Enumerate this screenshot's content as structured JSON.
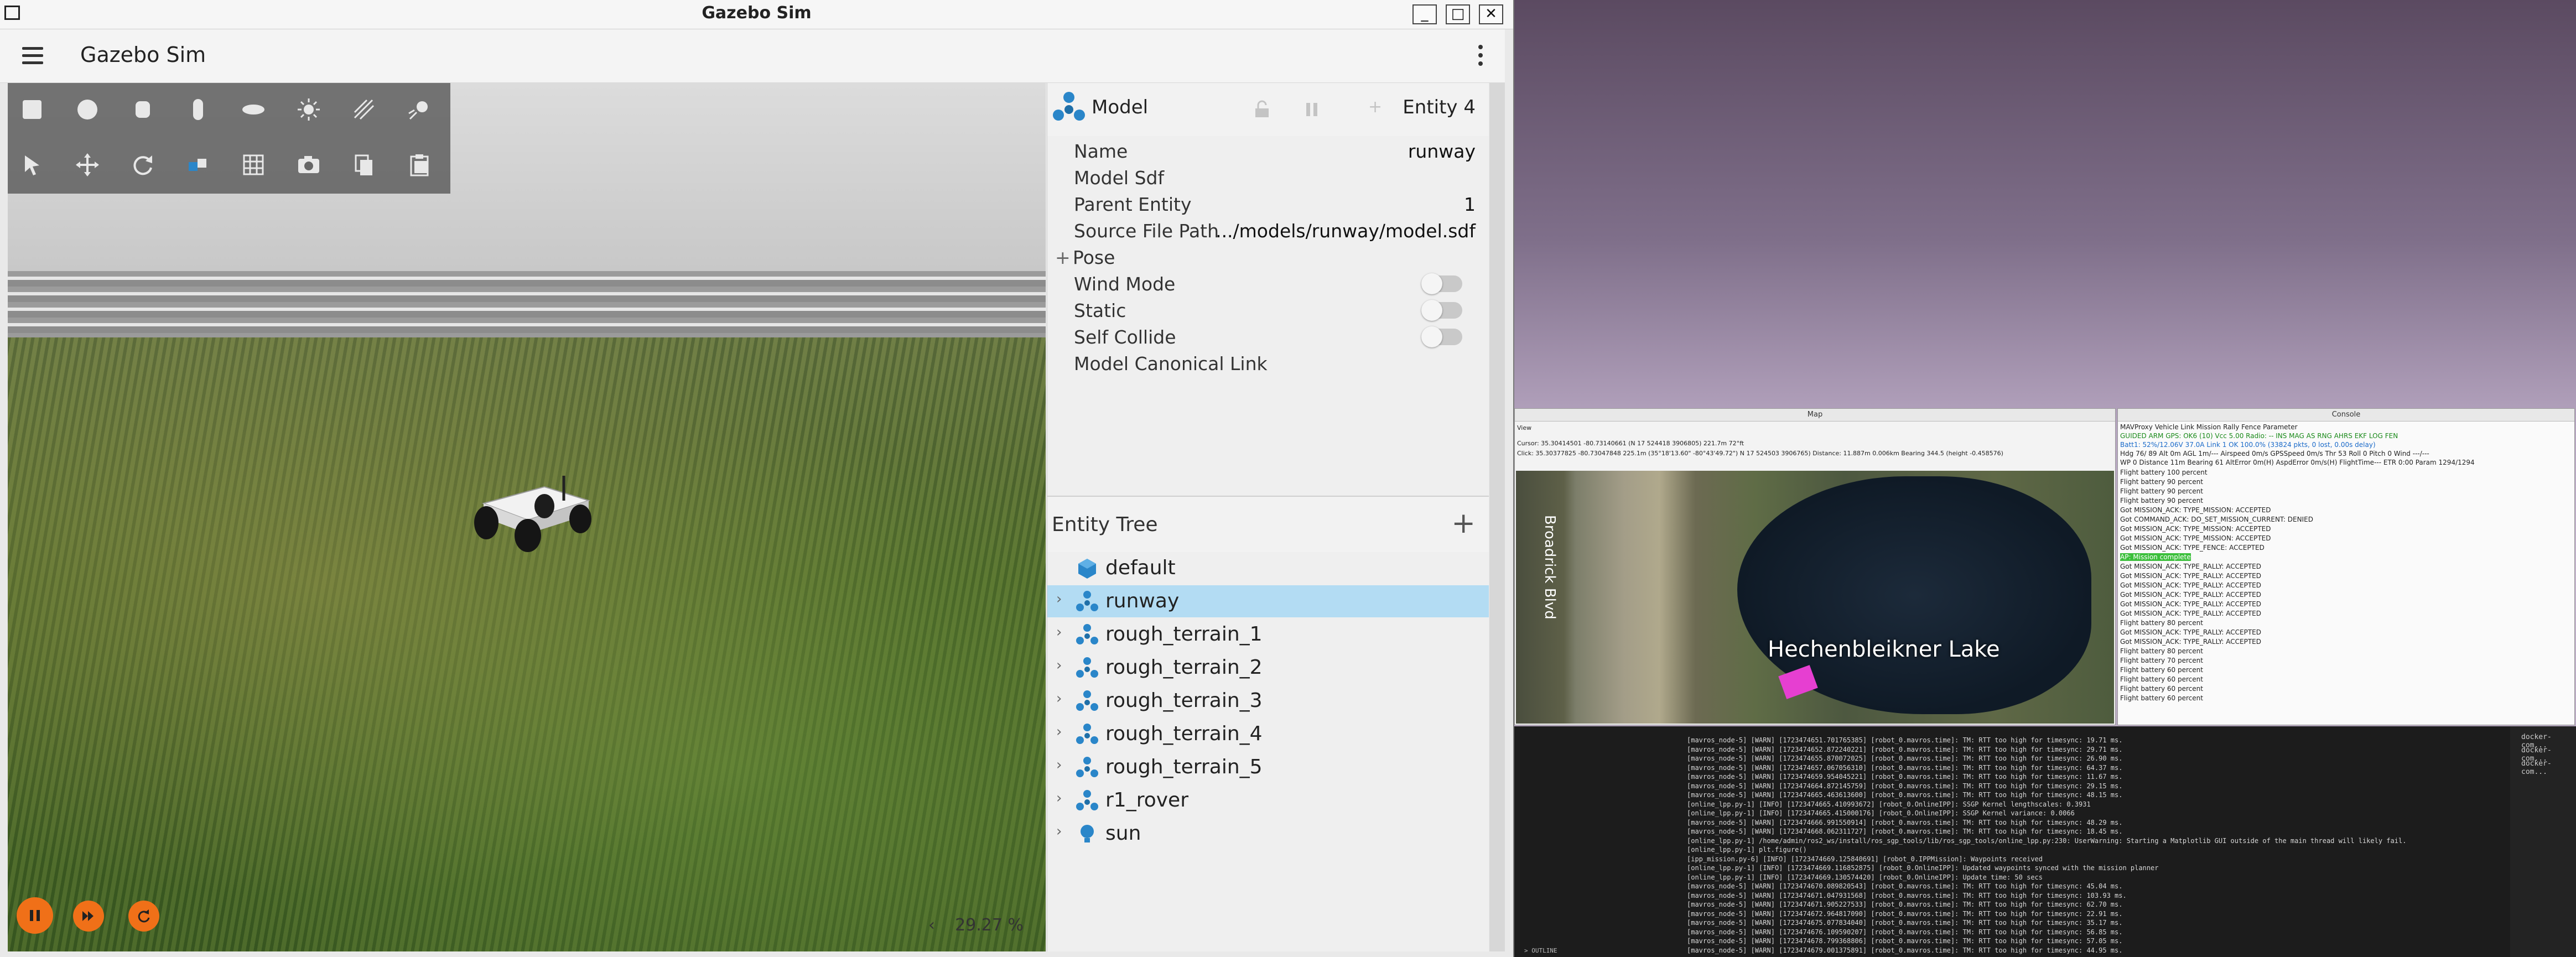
{
  "window": {
    "title": "Gazebo Sim",
    "minimize": "_",
    "maximize": "□",
    "close": "✕"
  },
  "app": {
    "title": "Gazebo Sim"
  },
  "scene": {
    "zoom": "29.27 %",
    "zoom_chevron": "‹"
  },
  "component_inspector": {
    "type_label": "Model",
    "entity_label": "Entity 4",
    "properties": {
      "name": {
        "key": "Name",
        "value": "runway"
      },
      "model_sdf": {
        "key": "Model Sdf",
        "value": ""
      },
      "parent_entity": {
        "key": "Parent Entity",
        "value": "1"
      },
      "source_file_path": {
        "key": "Source File Path",
        "value": ".../models/runway/model.sdf"
      },
      "pose": {
        "key": "Pose",
        "prefix": "+"
      },
      "wind_mode": {
        "key": "Wind Mode"
      },
      "static": {
        "key": "Static"
      },
      "self_collide": {
        "key": "Self Collide"
      },
      "model_canonical_link": {
        "key": "Model Canonical Link"
      }
    }
  },
  "entity_tree": {
    "title": "Entity Tree",
    "add": "+",
    "items": [
      {
        "name": "default",
        "selected": false,
        "icon": "world-icon",
        "expandable": false
      },
      {
        "name": "runway",
        "selected": true,
        "icon": "model-icon",
        "expandable": true
      },
      {
        "name": "rough_terrain_1",
        "selected": false,
        "icon": "model-icon",
        "expandable": true
      },
      {
        "name": "rough_terrain_2",
        "selected": false,
        "icon": "model-icon",
        "expandable": true
      },
      {
        "name": "rough_terrain_3",
        "selected": false,
        "icon": "model-icon",
        "expandable": true
      },
      {
        "name": "rough_terrain_4",
        "selected": false,
        "icon": "model-icon",
        "expandable": true
      },
      {
        "name": "rough_terrain_5",
        "selected": false,
        "icon": "model-icon",
        "expandable": true
      },
      {
        "name": "r1_rover",
        "selected": false,
        "icon": "model-icon",
        "expandable": true
      },
      {
        "name": "sun",
        "selected": false,
        "icon": "light-icon",
        "expandable": true
      }
    ]
  },
  "map_window": {
    "title": "Map",
    "menu": "View",
    "cursor": "Cursor: 35.30414501 -80.73140661 (N 17 524418 3906805) 221.7m 72°ft",
    "click": "Click: 35.30377825 -80.73047848  225.1m (35°18'13.60\" -80°43'49.72\") N 17 524503 3906765) Distance: 11.887m 0.006km Bearing 344.5 (height -0.458576)",
    "lake_label": "Hechenbleikner Lake",
    "street_label": "Broadrick Blvd"
  },
  "console_window": {
    "title": "Console",
    "tabs": "MAVProxy    Vehicle    Link    Mission    Rally    Fence    Parameter",
    "status1": "GUIDED      ARM     GPS: OK6 (10)     Vcc 5.00     Radio: --     INS    MAG    AS    RNG    AHRS    EKF    LOG    FEN",
    "status2": "Batt1: 52%/12.06V 37.0A     Link 1 OK 100.0% (33824 pkts, 0 lost, 0.00s delay)",
    "status3": "Hdg 76/ 89     Alt 0m     AGL 1m/---     Airspeed 0m/s     GPSSpeed 0m/s     Thr 53     Roll 0     Pitch 0     Wind ---/---",
    "status4": "WP 0     Distance 11m     Bearing 61     AltError 0m(H)     AspdError 0m/s(H)     FlightTime---     ETR 0:00     Param 1294/1294",
    "lines": [
      "Flight battery 100 percent",
      "Flight battery 90 percent",
      "Flight battery 90 percent",
      "Flight battery 90 percent",
      "Got MISSION_ACK: TYPE_MISSION: ACCEPTED",
      "Got COMMAND_ACK: DO_SET_MISSION_CURRENT: DENIED",
      "Got MISSION_ACK: TYPE_MISSION: ACCEPTED",
      "Got MISSION_ACK: TYPE_MISSION: ACCEPTED",
      "Got MISSION_ACK: TYPE_FENCE: ACCEPTED",
      "AP: Mission complete",
      "Got MISSION_ACK: TYPE_RALLY: ACCEPTED",
      "Got MISSION_ACK: TYPE_RALLY: ACCEPTED",
      "Got MISSION_ACK: TYPE_RALLY: ACCEPTED",
      "Got MISSION_ACK: TYPE_RALLY: ACCEPTED",
      "Got MISSION_ACK: TYPE_RALLY: ACCEPTED",
      "Got MISSION_ACK: TYPE_RALLY: ACCEPTED",
      "Flight battery 80 percent",
      "Got MISSION_ACK: TYPE_RALLY: ACCEPTED",
      "Got MISSION_ACK: TYPE_RALLY: ACCEPTED",
      "Flight battery 80 percent",
      "Flight battery 70 percent",
      "Flight battery 60 percent",
      "Flight battery 60 percent",
      "Flight battery 60 percent",
      "Flight battery 60 percent"
    ]
  },
  "terminal": {
    "lines": [
      "[mavros_node-5] [WARN] [1723474651.701765385] [robot_0.mavros.time]: TM: RTT too high for timesync: 19.71 ms.",
      "[mavros_node-5] [WARN] [1723474652.872240221] [robot_0.mavros.time]: TM: RTT too high for timesync: 29.71 ms.",
      "[mavros_node-5] [WARN] [1723474655.870072025] [robot_0.mavros.time]: TM: RTT too high for timesync: 26.90 ms.",
      "[mavros_node-5] [WARN] [1723474657.067056310] [robot_0.mavros.time]: TM: RTT too high for timesync: 64.37 ms.",
      "[mavros_node-5] [WARN] [1723474659.954045221] [robot_0.mavros.time]: TM: RTT too high for timesync: 11.67 ms.",
      "[mavros_node-5] [WARN] [1723474664.872145759] [robot_0.mavros.time]: TM: RTT too high for timesync: 29.15 ms.",
      "[mavros_node-5] [WARN] [1723474665.463613600] [robot_0.mavros.time]: TM: RTT too high for timesync: 48.15 ms.",
      "[online_lpp.py-1] [INFO] [1723474665.410993672] [robot_0.OnlineIPP]: SSGP Kernel lengthscales: 0.3931",
      "[online_lpp.py-1] [INFO] [1723474665.415000176] [robot_0.OnlineIPP]: SSGP Kernel variance: 0.0066",
      "[mavros_node-5] [WARN] [1723474666.991550914] [robot_0.mavros.time]: TM: RTT too high for timesync: 48.29 ms.",
      "[mavros_node-5] [WARN] [1723474668.062311727] [robot_0.mavros.time]: TM: RTT too high for timesync: 18.45 ms.",
      "[online_lpp.py-1] /home/admin/ros2_ws/install/ros_sgp_tools/lib/ros_sgp_tools/online_lpp.py:230: UserWarning: Starting a Matplotlib GUI outside of the main thread will likely fail.",
      "[online_lpp.py-1]   plt.figure()",
      "[ipp_mission.py-6] [INFO] [1723474669.125840691] [robot_0.IPPMission]: Waypoints received",
      "[online_lpp.py-1] [INFO] [1723474669.116852875] [robot_0.OnlineIPP]: Updated waypoints synced with the mission planner",
      "[online_lpp.py-1] [INFO] [1723474669.130574420] [robot_0.OnlineIPP]: Update time: 50 secs",
      "[mavros_node-5] [WARN] [1723474670.089820543] [robot_0.mavros.time]: TM: RTT too high for timesync: 45.04 ms.",
      "[mavros_node-5] [WARN] [1723474671.047931568] [robot_0.mavros.time]: TM: RTT too high for timesync: 103.93 ms.",
      "[mavros_node-5] [WARN] [1723474671.905227533] [robot_0.mavros.time]: TM: RTT too high for timesync: 62.70 ms.",
      "[mavros_node-5] [WARN] [1723474672.964817090] [robot_0.mavros.time]: TM: RTT too high for timesync: 22.91 ms.",
      "[mavros_node-5] [WARN] [1723474675.077834040] [robot_0.mavros.time]: TM: RTT too high for timesync: 35.17 ms.",
      "[mavros_node-5] [WARN] [1723474676.109590207] [robot_0.mavros.time]: TM: RTT too high for timesync: 56.85 ms.",
      "[mavros_node-5] [WARN] [1723474678.799368806] [robot_0.mavros.time]: TM: RTT too high for timesync: 57.05 ms.",
      "[mavros_node-5] [WARN] [1723474679.001375891] [robot_0.mavros.time]: TM: RTT too high for timesync: 44.95 ms."
    ],
    "side_tabs": [
      "docker-com...",
      "docker-com...",
      "docker-com..."
    ],
    "outline": "> OUTLINE"
  },
  "colors": {
    "accent_orange": "#f07018",
    "selection_blue": "#b3dcf3",
    "model_icon": "#2a86c9"
  }
}
